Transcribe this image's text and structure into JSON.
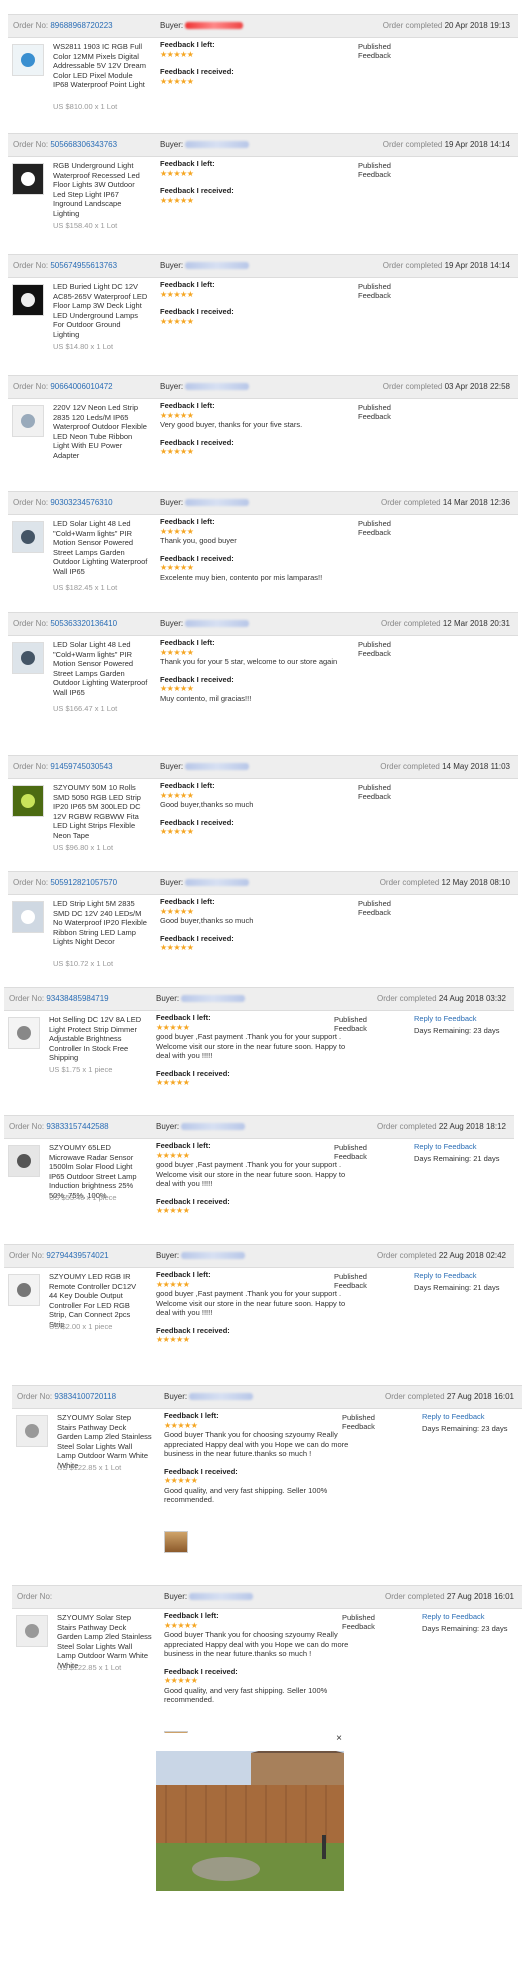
{
  "labels": {
    "order_no": "Order No:",
    "buyer": "Buyer:",
    "order_completed": "Order completed",
    "feedback_left": "Feedback I left:",
    "feedback_received": "Feedback I received:",
    "published_feedback": "Published Feedback",
    "reply_to_feedback": "Reply to Feedback"
  },
  "colors": {
    "stars": "#f5a623",
    "link": "#2a6db5",
    "header_bg": "#eeeeee"
  },
  "orders": [
    {
      "no": "89688968720223",
      "completed": "20 Apr 2018 19:13",
      "title": "WS2811 1903 IC RGB Full Color 12MM Pixels Digital Addressable 5V 12V Dream Color LED Pixel Module IP68 Waterproof Point Light",
      "price": "US $810.00 x 1 Lot",
      "left_stars": "★★★★★",
      "left_text": "",
      "recv_stars": "★★★★★",
      "recv_text": "",
      "reply": "",
      "days": ""
    },
    {
      "no": "505668306343763",
      "completed": "19 Apr 2018 14:14",
      "title": "RGB Underground Light Waterproof Recessed Led Floor Lights 3W Outdoor Led Step Light IP67 Inground Landscape Lighting",
      "price": "US $158.40 x 1 Lot",
      "left_stars": "★★★★★",
      "left_text": "",
      "recv_stars": "★★★★★",
      "recv_text": "",
      "reply": "",
      "days": ""
    },
    {
      "no": "505674955613763",
      "completed": "19 Apr 2018 14:14",
      "title": "LED Buried Light DC 12V AC85-265V Waterproof LED Floor Lamp 3W Deck Light LED Underground Lamps For Outdoor Ground Lighting",
      "price": "US $14.80 x 1 Lot",
      "left_stars": "★★★★★",
      "left_text": "",
      "recv_stars": "★★★★★",
      "recv_text": "",
      "reply": "",
      "days": ""
    },
    {
      "no": "90664006010472",
      "completed": "03 Apr 2018 22:58",
      "title": "220V 12V Neon Led Strip 2835 120 Leds/M IP65 Waterproof Outdoor Flexible LED Neon Tube Ribbon Light With EU Power Adapter",
      "price": "",
      "left_stars": "★★★★★",
      "left_text": "Very good buyer, thanks for your five stars.",
      "recv_stars": "★★★★★",
      "recv_text": "",
      "reply": "",
      "days": ""
    },
    {
      "no": "90303234576310",
      "completed": "14 Mar 2018 12:36",
      "title": "LED Solar Light 48 Led \"Cold+Warm lights\" PIR Motion Sensor Powered Street Lamps Garden Outdoor Lighting Waterproof Wall IP65",
      "price": "US $182.45 x 1 Lot",
      "left_stars": "★★★★★",
      "left_text": "Thank you, good buyer",
      "recv_stars": "★★★★★",
      "recv_text": "Excelente muy bien, contento por mis lamparas!!",
      "reply": "",
      "days": ""
    },
    {
      "no": "505363320136410",
      "completed": "12 Mar 2018 20:31",
      "title": "LED Solar Light 48 Led \"Cold+Warm lights\" PIR Motion Sensor Powered Street Lamps Garden Outdoor Lighting Waterproof Wall IP65",
      "price": "US $166.47 x 1 Lot",
      "left_stars": "★★★★★",
      "left_text": "Thank you for your 5 star, welcome to our store again",
      "recv_stars": "★★★★★",
      "recv_text": "Muy contento, mil gracias!!!",
      "reply": "",
      "days": ""
    },
    {
      "no": "91459745030543",
      "completed": "14 May 2018 11:03",
      "title": "SZYOUMY 50M 10 Rolls SMD 5050 RGB LED Strip IP20 IP65 5M 300LED DC 12V RGBW RGBWW Fita LED Light Strips Flexible Neon Tape",
      "price": "US $96.80 x 1 Lot",
      "left_stars": "★★★★★",
      "left_text": "Good buyer,thanks so much",
      "recv_stars": "★★★★★",
      "recv_text": "",
      "reply": "",
      "days": ""
    },
    {
      "no": "505912821057570",
      "completed": "12 May 2018 08:10",
      "title": "LED Strip Light 5M 2835 SMD DC 12V 240 LEDs/M No Waterproof IP20 Flexible Ribbon String LED Lamp Lights Night Decor",
      "price": "US $10.72 x 1 Lot",
      "left_stars": "★★★★★",
      "left_text": "Good buyer,thanks so much",
      "recv_stars": "★★★★★",
      "recv_text": "",
      "reply": "",
      "days": ""
    },
    {
      "no": "93438485984719",
      "completed": "24 Aug 2018 03:32",
      "title": "Hot Selling DC 12V 8A LED Light Protect Strip Dimmer Adjustable Brightness Controller In Stock Free Shipping",
      "price": "US $1.75 x 1 piece",
      "left_stars": "★★★★★",
      "left_text": "good buyer ,Fast payment .Thank you for your support . Welcome visit our store in the near future soon. Happy to deal with you !!!!!",
      "recv_stars": "★★★★★",
      "recv_text": "",
      "reply": "Reply to Feedback",
      "days": "Days Remaining: 23 days"
    },
    {
      "no": "93833157442588",
      "completed": "22 Aug 2018 18:12",
      "title": "SZYOUMY 65LED Microwave Radar Sensor 1500lm Solar Flood Light IP65 Outdoor Street Lamp Induction brightness 25% 50%, 75%, 100%",
      "price": "US $53.40 x 1 piece",
      "left_stars": "★★★★★",
      "left_text": "good buyer ,Fast payment .Thank you for your support . Welcome visit our store in the near future soon. Happy to deal with you !!!!!",
      "recv_stars": "★★★★★",
      "recv_text": "",
      "reply": "Reply to Feedback",
      "days": "Days Remaining: 21 days"
    },
    {
      "no": "92794439574021",
      "completed": "22 Aug 2018 02:42",
      "title": "SZYOUMY LED RGB IR Remote Controller DC12V 44 Key Double Output Controller For LED RGB Strip, Can Connect 2pcs Strip",
      "price": "US $2.00 x 1 piece",
      "left_stars": "★★★★★",
      "left_text": "good buyer ,Fast payment .Thank you for your support . Welcome visit our store in the near future soon. Happy to deal with you !!!!!",
      "recv_stars": "★★★★★",
      "recv_text": "",
      "reply": "Reply to Feedback",
      "days": "Days Remaining: 21 days"
    },
    {
      "no": "93834100720118",
      "completed": "27 Aug 2018 16:01",
      "title": "SZYOUMY Solar Step Stairs Pathway Deck Garden Lamp 2led Stainless Steel Solar Lights Wall Lamp Outdoor Warm White /White",
      "price": "US $122.85 x 1 Lot",
      "left_stars": "★★★★★",
      "left_text": "Good buyer Thank you for choosing szyoumy Really appreciated Happy deal with you Hope we can do more business in the near future.thanks so much !",
      "recv_stars": "★★★★★",
      "recv_text": "Good quality, and very fast shipping. Seller 100% recommended.",
      "reply": "Reply to Feedback",
      "days": "Days Remaining: 23 days"
    },
    {
      "no": "",
      "completed": "27 Aug 2018 16:01",
      "title": "SZYOUMY Solar Step Stairs Pathway Deck Garden Lamp 2led Stainless Steel Solar Lights Wall Lamp Outdoor Warm White /White",
      "price": "US $122.85 x 1 Lot",
      "left_stars": "★★★★★",
      "left_text": "Good buyer Thank you for choosing szyoumy Really appreciated Happy deal with you Hope we can do more business in the near future.thanks so much !",
      "recv_stars": "★★★★★",
      "recv_text": "Good quality, and very fast shipping. Seller 100% recommended.",
      "reply": "Reply to Feedback",
      "days": "Days Remaining: 23 days"
    }
  ],
  "popup": {
    "close": "×"
  }
}
